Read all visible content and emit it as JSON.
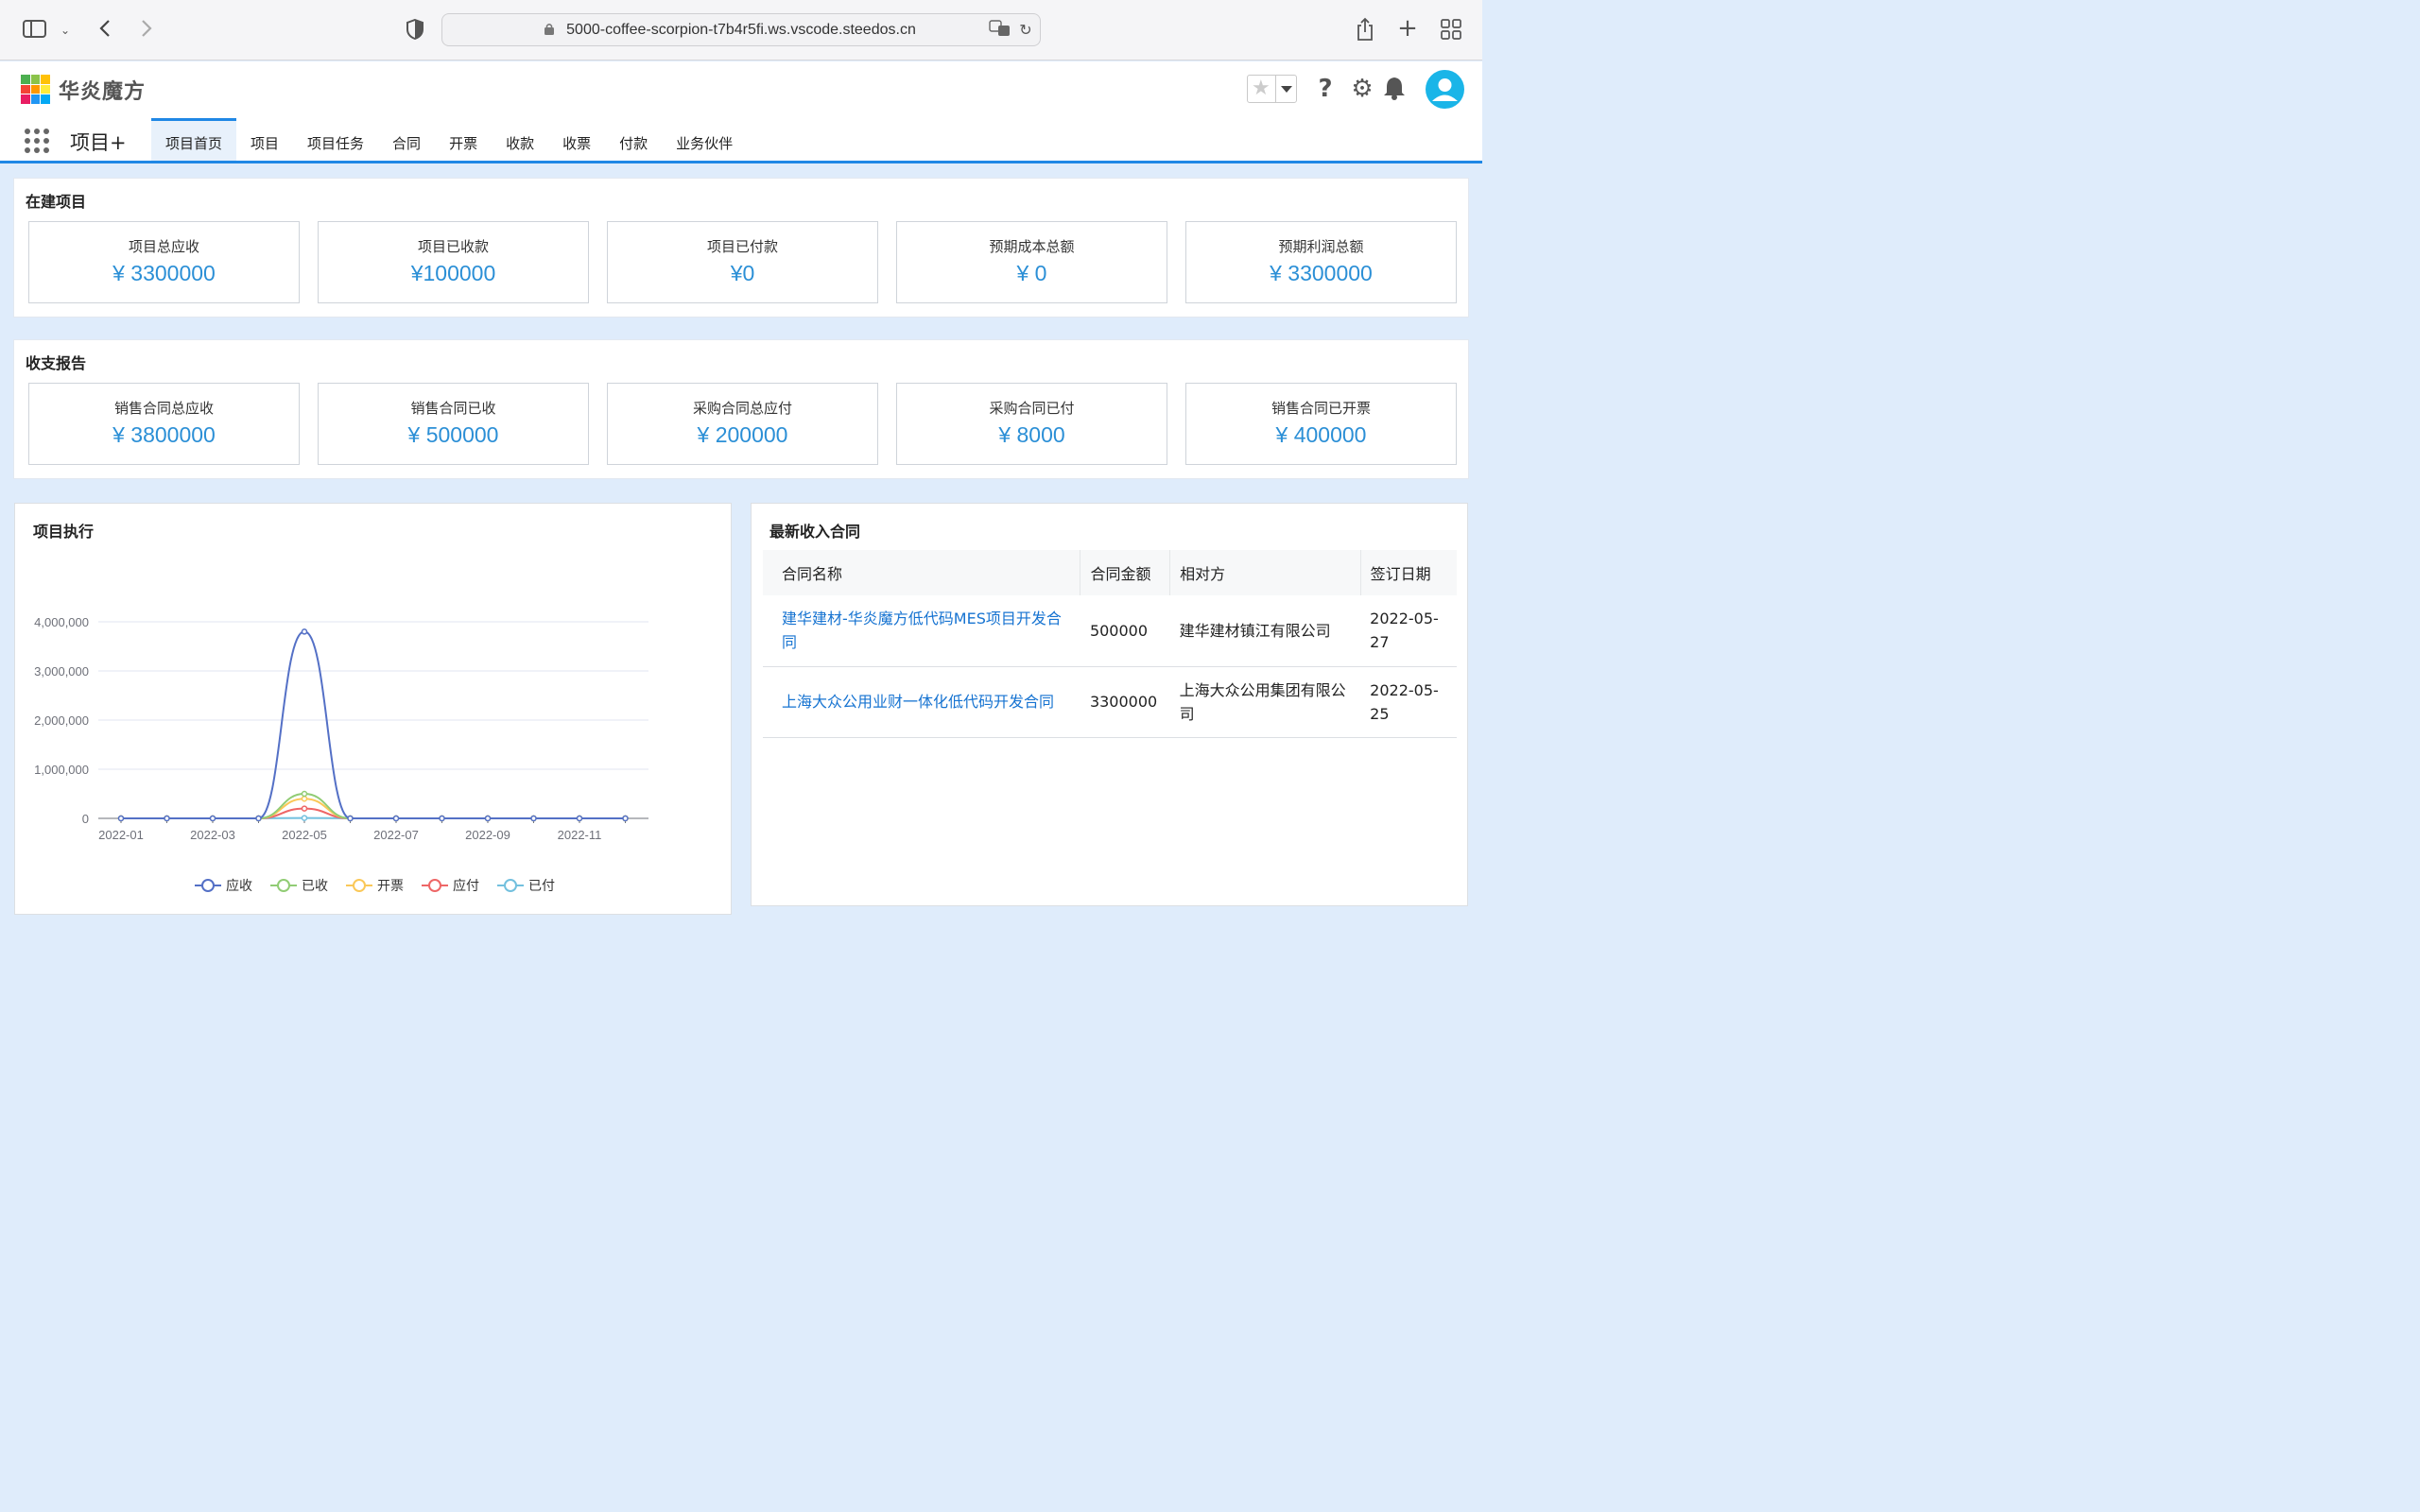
{
  "browser": {
    "url": "5000-coffee-scorpion-t7b4r5fi.ws.vscode.steedos.cn"
  },
  "header": {
    "brand": "华炎魔方",
    "app_name": "项目+",
    "nav": [
      {
        "label": "项目首页",
        "active": true
      },
      {
        "label": "项目"
      },
      {
        "label": "项目任务"
      },
      {
        "label": "合同"
      },
      {
        "label": "开票"
      },
      {
        "label": "收款"
      },
      {
        "label": "收票"
      },
      {
        "label": "付款"
      },
      {
        "label": "业务伙伴"
      }
    ]
  },
  "in_progress": {
    "title": "在建项目",
    "cards": [
      {
        "label": "项目总应收",
        "value": "¥ 3300000"
      },
      {
        "label": "项目已收款",
        "value": "¥100000"
      },
      {
        "label": "项目已付款",
        "value": "¥0"
      },
      {
        "label": "预期成本总额",
        "value": "¥ 0"
      },
      {
        "label": "预期利润总额",
        "value": "¥ 3300000"
      }
    ]
  },
  "finance": {
    "title": "收支报告",
    "cards": [
      {
        "label": "销售合同总应收",
        "value": "¥ 3800000"
      },
      {
        "label": "销售合同已收",
        "value": "¥ 500000"
      },
      {
        "label": "采购合同总应付",
        "value": "¥ 200000"
      },
      {
        "label": "采购合同已付",
        "value": "¥ 8000"
      },
      {
        "label": "销售合同已开票",
        "value": "¥ 400000"
      }
    ]
  },
  "chart_panel": {
    "title": "项目执行"
  },
  "chart_data": {
    "type": "line",
    "x": [
      "2022-01",
      "2022-02",
      "2022-03",
      "2022-04",
      "2022-05",
      "2022-06",
      "2022-07",
      "2022-08",
      "2022-09",
      "2022-10",
      "2022-11",
      "2022-12"
    ],
    "x_tick_labels": [
      "2022-01",
      "2022-03",
      "2022-05",
      "2022-07",
      "2022-09",
      "2022-11"
    ],
    "y_tick_labels": [
      "0",
      "1,000,000",
      "2,000,000",
      "3,000,000",
      "4,000,000"
    ],
    "ylim": [
      0,
      4000000
    ],
    "grid": true,
    "legend_position": "bottom",
    "series": [
      {
        "name": "应收",
        "color": "#5470c6",
        "values": [
          0,
          0,
          0,
          0,
          3800000,
          0,
          0,
          0,
          0,
          0,
          0,
          0
        ]
      },
      {
        "name": "已收",
        "color": "#91cc75",
        "values": [
          0,
          0,
          0,
          0,
          500000,
          0,
          0,
          0,
          0,
          0,
          0,
          0
        ]
      },
      {
        "name": "开票",
        "color": "#fac858",
        "values": [
          0,
          0,
          0,
          0,
          400000,
          0,
          0,
          0,
          0,
          0,
          0,
          0
        ]
      },
      {
        "name": "应付",
        "color": "#ee6666",
        "values": [
          0,
          0,
          0,
          0,
          200000,
          0,
          0,
          0,
          0,
          0,
          0,
          0
        ]
      },
      {
        "name": "已付",
        "color": "#73c0de",
        "values": [
          0,
          0,
          0,
          0,
          8000,
          0,
          0,
          0,
          0,
          0,
          0,
          0
        ]
      }
    ]
  },
  "contracts": {
    "title": "最新收入合同",
    "columns": [
      "合同名称",
      "合同金额",
      "相对方",
      "签订日期"
    ],
    "rows": [
      {
        "name": "建华建材-华炎魔方低代码MES项目开发合同",
        "amount": "500000",
        "party": "建华建材镇江有限公司",
        "date": "2022-05-27"
      },
      {
        "name": "上海大众公用业财一体化低代码开发合同",
        "amount": "3300000",
        "party": "上海大众公用集团有限公司",
        "date": "2022-05-25"
      }
    ]
  }
}
